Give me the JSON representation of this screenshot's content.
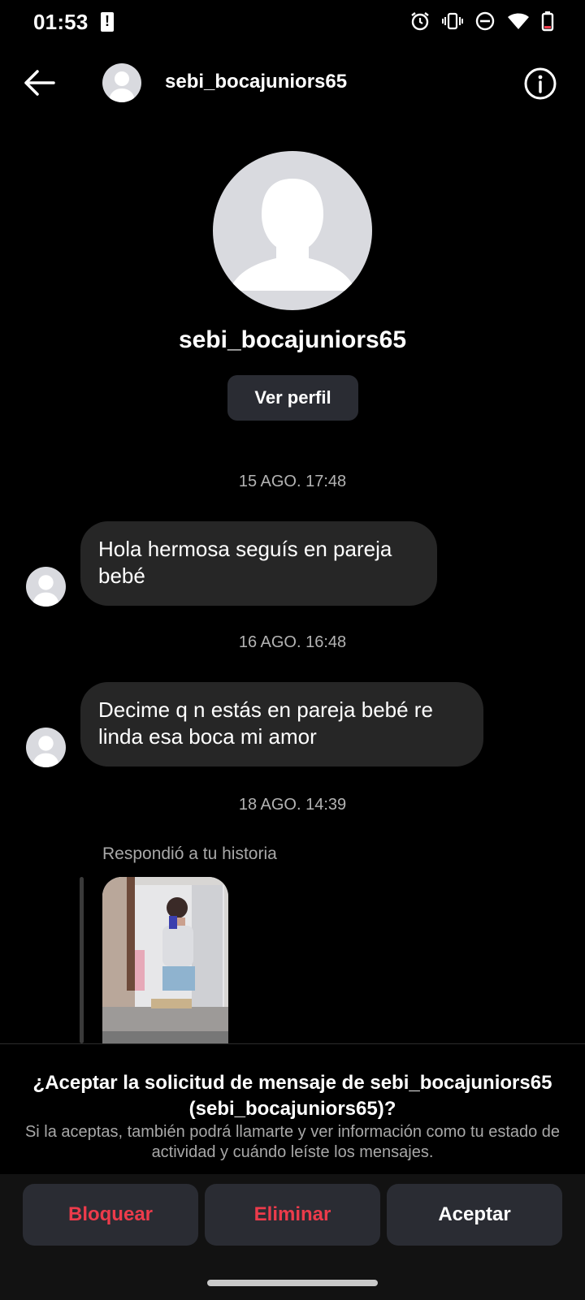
{
  "status_bar": {
    "time": "01:53",
    "icons": [
      "alert-icon",
      "alarm-icon",
      "vibrate-icon",
      "do-not-disturb-icon",
      "wifi-icon",
      "battery-icon"
    ]
  },
  "header": {
    "username": "sebi_bocajuniors65",
    "back_icon": "arrow-left-icon",
    "info_icon": "info-icon"
  },
  "profile": {
    "name": "sebi_bocajuniors65",
    "view_profile_label": "Ver perfil"
  },
  "messages": [
    {
      "timestamp": "15 AGO. 17:48",
      "text": "Hola hermosa seguís en pareja bebé"
    },
    {
      "timestamp": "16 AGO. 16:48",
      "text": "Decime q n estás en pareja bebé re linda esa boca mi amor"
    }
  ],
  "story_reply": {
    "timestamp": "18 AGO. 14:39",
    "label": "Respondió a tu historia"
  },
  "request": {
    "title": "¿Aceptar la solicitud de mensaje de sebi_bocajuniors65 (sebi_bocajuniors65)?",
    "subtitle": "Si la aceptas, también podrá llamarte y ver información como tu estado de actividad y cuándo leíste los mensajes.",
    "buttons": {
      "block": "Bloquear",
      "delete": "Eliminar",
      "accept": "Aceptar"
    }
  },
  "colors": {
    "background": "#000000",
    "bubble": "#262626",
    "button": "#2a2c33",
    "danger": "#ed3b4b",
    "muted": "#a8a8a8"
  }
}
